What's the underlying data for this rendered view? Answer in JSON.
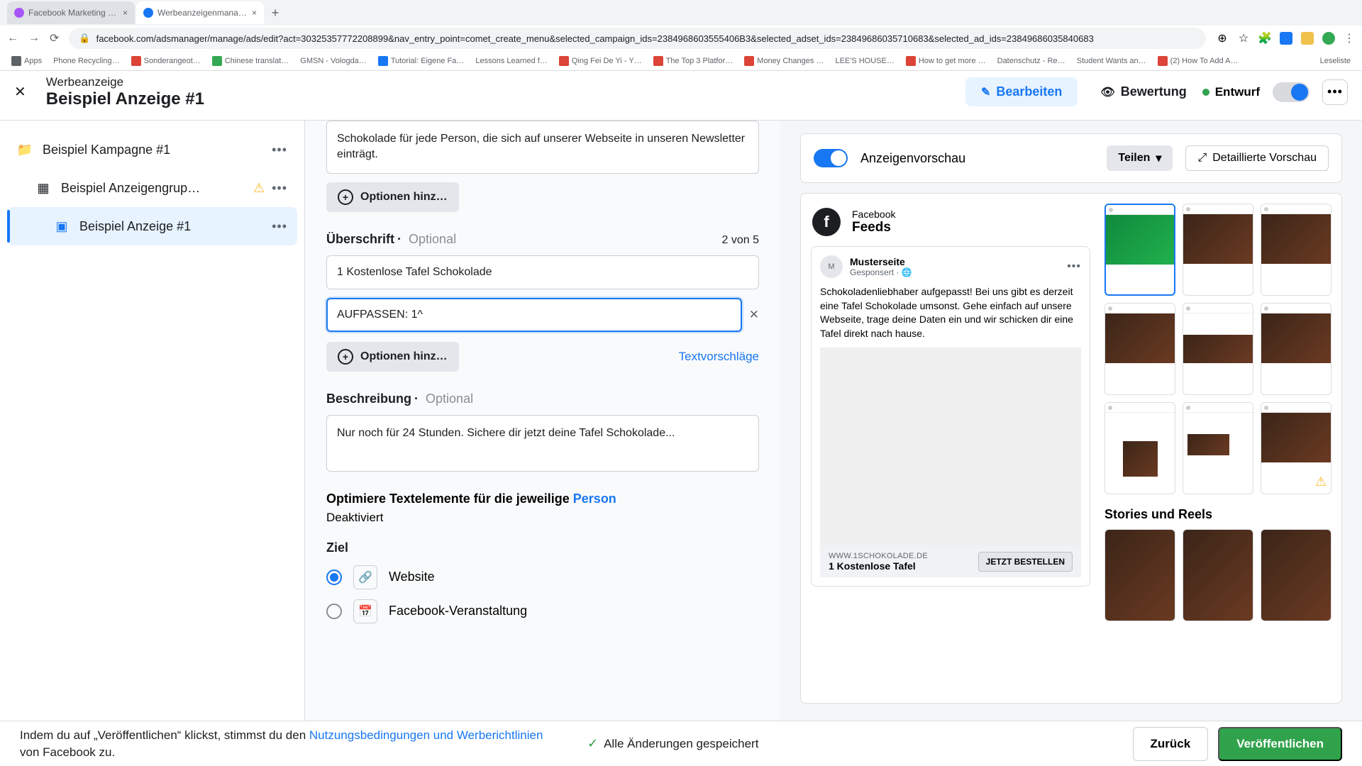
{
  "browser": {
    "tabs": [
      {
        "title": "Facebook Marketing & Werbe…",
        "favicon": "#a855f7"
      },
      {
        "title": "Werbeanzeigenmanager - We…",
        "favicon": "#1877f2",
        "active": true
      }
    ],
    "url": "facebook.com/adsmanager/manage/ads/edit?act=30325357772208899&nav_entry_point=comet_create_menu&selected_campaign_ids=2384968603555406B3&selected_adset_ids=23849686035710683&selected_ad_ids=23849686035840683",
    "bookmarks": [
      "Apps",
      "Phone Recycling…",
      "Sonderangeot…",
      "Chinese translat…",
      "GMSN - Vologda…",
      "Tutorial: Eigene Fa…",
      "Lessons Learned f…",
      "Qing Fei De Yi - Y…",
      "The Top 3 Platfor…",
      "Money Changes …",
      "LEE'S HOUSE…",
      "How to get more …",
      "Datenschutz - Re…",
      "Student Wants an…",
      "(2) How To Add A…"
    ],
    "other_bookmarks": "Leseliste"
  },
  "header": {
    "sub": "Werbeanzeige",
    "title": "Beispiel Anzeige #1",
    "edit": "Bearbeiten",
    "review": "Bewertung",
    "status": "Entwurf"
  },
  "tree": {
    "campaign": "Beispiel Kampagne #1",
    "adset": "Beispiel Anzeigengrup…",
    "ad": "Beispiel Anzeige #1"
  },
  "form": {
    "primary_text": "Schokolade für jede Person, die sich auf unserer Webseite in unseren Newsletter einträgt.",
    "add_option": "Optionen hinz…",
    "headline": {
      "label": "Überschrift",
      "optional": "Optional",
      "count": "2 von 5",
      "h1": "1 Kostenlose Tafel Schokolade",
      "h2": "AUFPASSEN: 1^"
    },
    "textv": "Textvorschläge",
    "desc": {
      "label": "Beschreibung",
      "optional": "Optional",
      "value": "Nur noch für 24 Stunden. Sichere dir jetzt deine Tafel Schokolade..."
    },
    "opt_text": {
      "pre": "Optimiere Textelemente für die jeweilige ",
      "person": "Person",
      "state": "Deaktiviert"
    },
    "dest": {
      "label": "Ziel",
      "website": "Website",
      "fbevent": "Facebook-Veranstaltung"
    }
  },
  "preview": {
    "title": "Anzeigenvorschau",
    "share": "Teilen",
    "detailed": "Detaillierte Vorschau",
    "feed_src_sm": "Facebook",
    "feed_src_lg": "Feeds",
    "post": {
      "page": "Musterseite",
      "sponsored": "Gesponsert",
      "body": "Schokoladenliebhaber aufgepasst! Bei uns gibt es derzeit eine Tafel Schokolade umsonst. Gehe einfach auf unsere Webseite, trage deine Daten ein und wir schicken dir eine Tafel direkt nach hause.",
      "url": "WWW.1SCHOKOLADE.DE",
      "headline": "1 Kostenlose Tafel",
      "cta": "JETZT BESTELLEN"
    },
    "stories": "Stories und Reels"
  },
  "footer": {
    "consent_pre": "Indem du auf „Veröffentlichen“ klickst, stimmst du den ",
    "consent_link": "Nutzungsbedingungen und Werberichtlinien",
    "consent_post": " von Facebook zu.",
    "saved": "Alle Änderungen gespeichert",
    "back": "Zurück",
    "publish": "Veröffentlichen"
  }
}
